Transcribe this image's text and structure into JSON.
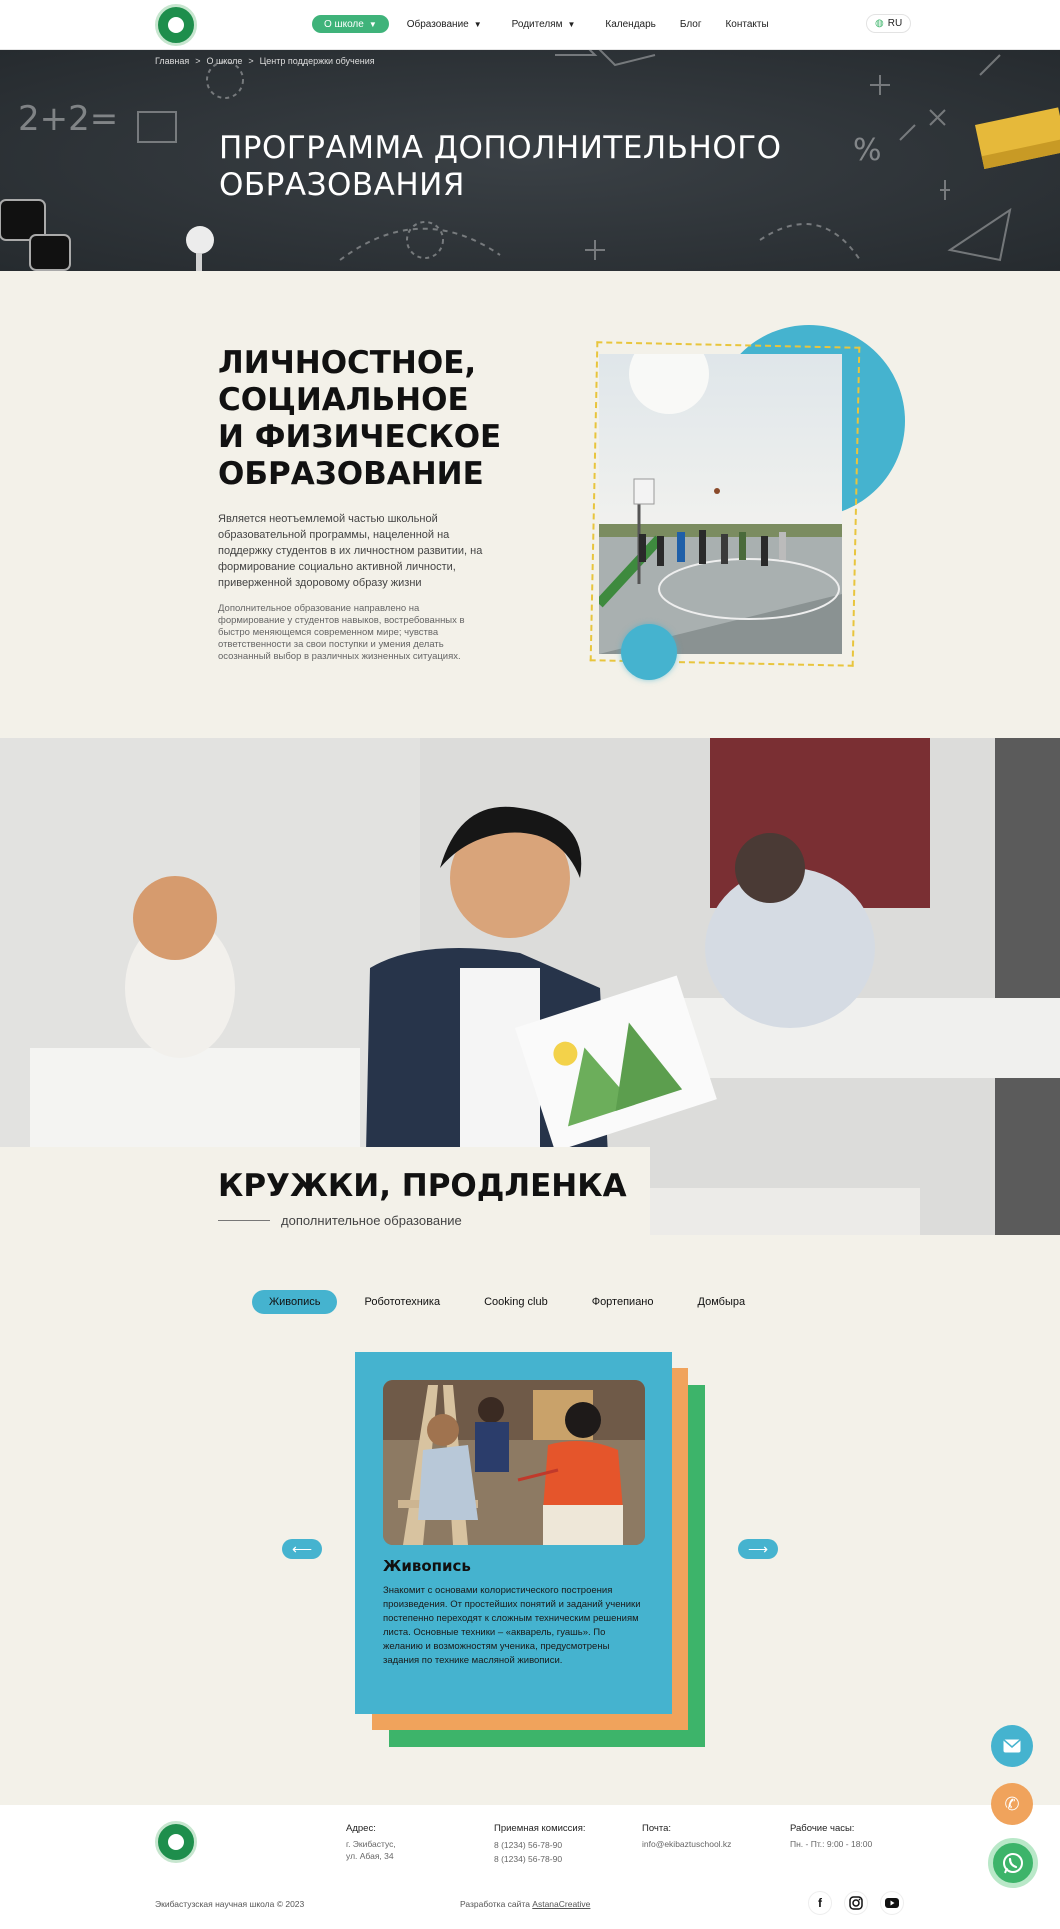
{
  "header": {
    "nav": [
      {
        "label": "О школе",
        "active": true,
        "dropdown": true
      },
      {
        "label": "Образование",
        "active": false,
        "dropdown": true
      },
      {
        "label": "Родителям",
        "active": false,
        "dropdown": true
      },
      {
        "label": "Календарь",
        "active": false,
        "dropdown": false
      },
      {
        "label": "Блог",
        "active": false,
        "dropdown": false
      },
      {
        "label": "Контакты",
        "active": false,
        "dropdown": false
      }
    ],
    "lang": "RU"
  },
  "breadcrumb": [
    "Главная",
    "О школе",
    "Центр поддержки обучения"
  ],
  "hero": {
    "title_line1": "ПРОГРАММА ДОПОЛНИТЕЛЬНОГО",
    "title_line2": "ОБРАЗОВАНИЯ"
  },
  "section1": {
    "title_lines": [
      "ЛИЧНОСТНОЕ,",
      "СОЦИАЛЬНОЕ",
      "И ФИЗИЧЕСКОЕ",
      "ОБРАЗОВАНИЕ"
    ],
    "paragraph1": "Является неотъемлемой частью школьной образовательной программы, нацеленной на поддержку студентов в их личностном развитии, на формирование социально активной личности, приверженной здоровому образу жизни",
    "paragraph2": "Дополнительное образование направлено на формирование у студентов навыков, востребованных в быстро меняющемся современном мире; чувства ответственности за свои поступки и умения делать осознанный выбор в различных жизненных ситуациях."
  },
  "section2": {
    "title": "КРУЖКИ, ПРОДЛЕНКА",
    "subtitle": "дополнительное образование"
  },
  "tabs": [
    {
      "label": "Живопись",
      "active": true
    },
    {
      "label": "Робототехника",
      "active": false
    },
    {
      "label": "Cooking club",
      "active": false
    },
    {
      "label": "Фортепиано",
      "active": false
    },
    {
      "label": "Домбыра",
      "active": false
    }
  ],
  "card": {
    "title": "Живопись",
    "description": "Знакомит с основами колористического построения произведения. От простейших понятий и заданий ученики постепенно переходят к сложным техническим решениям листа. Основные техники – «акварель, гуашь». По желанию и возможностям ученика, предусмотрены задания по технике масляной живописи."
  },
  "footer": {
    "address_label": "Адрес:",
    "address_lines": [
      "г. Экибастус,",
      "ул. Абая, 34"
    ],
    "admission_label": "Приемная комиссия:",
    "phones": [
      "8 (1234) 56-78-90",
      "8 (1234) 56-78-90"
    ],
    "mail_label": "Почта:",
    "mail": "info@ekibaztuschool.kz",
    "hours_label": "Рабочие часы:",
    "hours": "Пн. - Пт.: 9:00 - 18:00",
    "copyright": "Экибастузская научная школа © 2023",
    "developer_prefix": "Разработка сайта",
    "developer_name": "AstanaCreative"
  },
  "colors": {
    "accent_blue": "#45b3cf",
    "accent_green": "#3db46a",
    "accent_orange": "#f0a35c",
    "background": "#f3f1e9",
    "hero_dark": "#2d3338"
  },
  "icons": [
    "logo-emblem",
    "globe-icon",
    "arrow-left-icon",
    "arrow-right-icon",
    "facebook-icon",
    "instagram-icon",
    "youtube-icon",
    "mail-icon",
    "phone-icon",
    "whatsapp-icon"
  ]
}
